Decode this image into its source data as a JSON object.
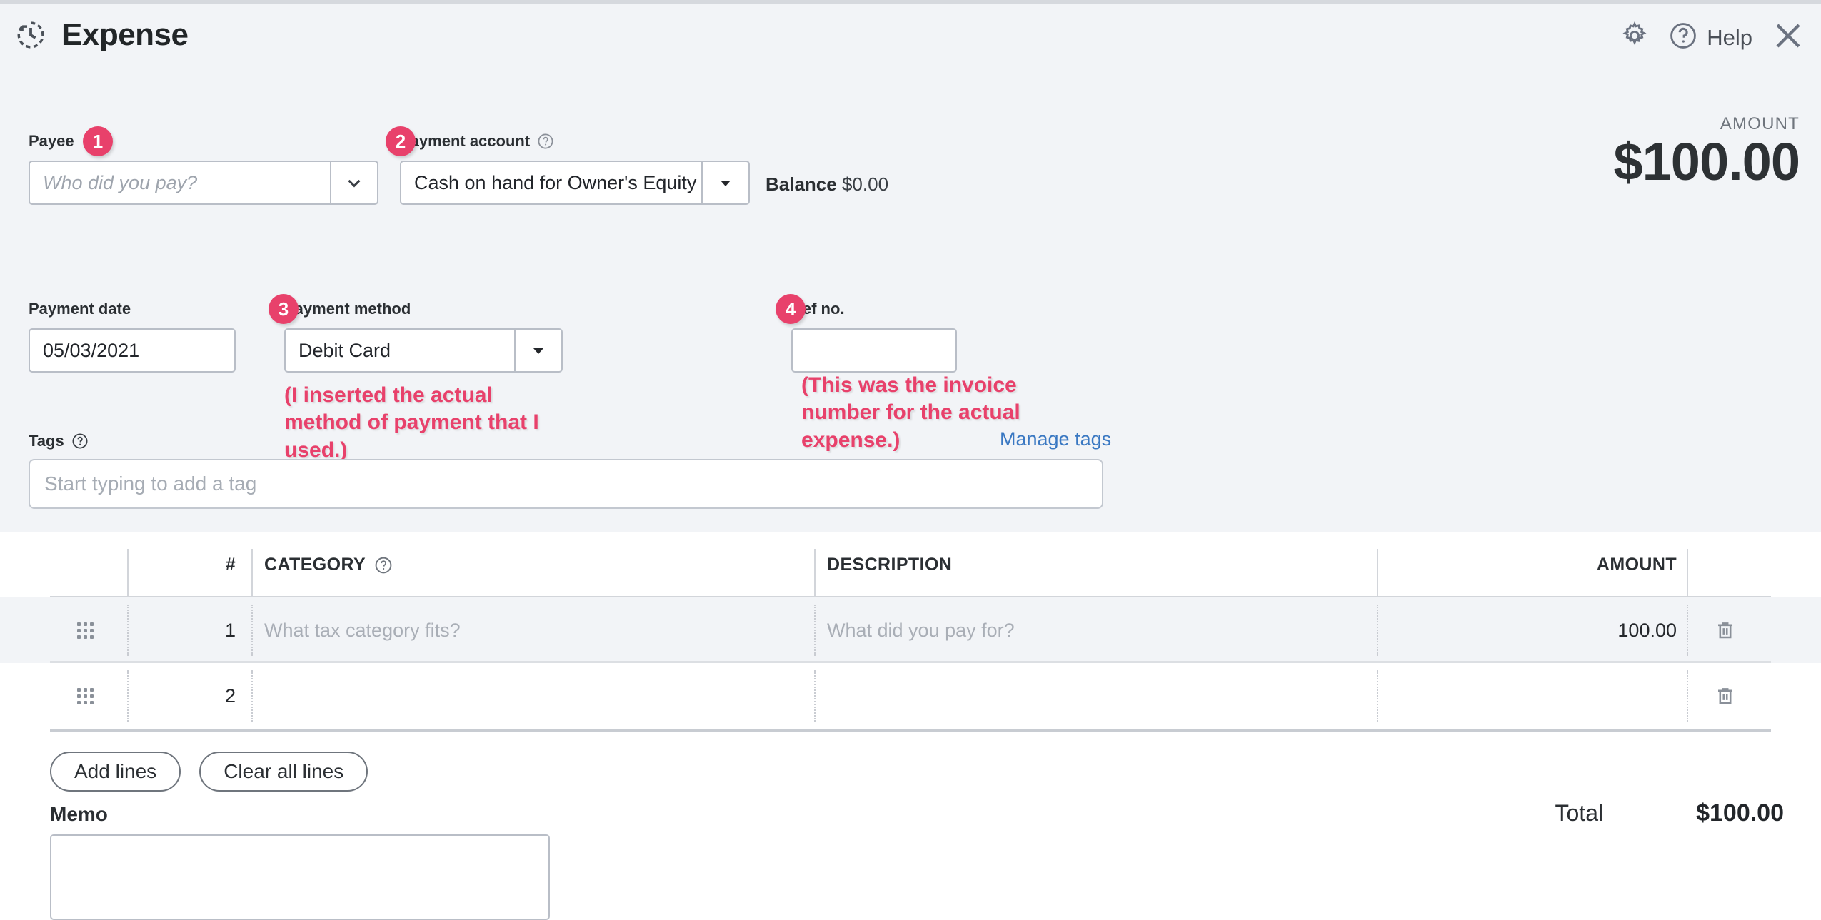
{
  "header": {
    "title": "Expense",
    "logo_icon": "history-clock-icon",
    "gear_icon": "gear-icon",
    "help_icon": "question-circle-icon",
    "help_label": "Help",
    "close_icon": "close-x-icon"
  },
  "colors": {
    "badge": "#e8416b",
    "annotation": "#e8416b",
    "link": "#3a78c2",
    "panel": "#f2f4f7"
  },
  "payee": {
    "label": "Payee",
    "badge": "1",
    "value": "",
    "placeholder": "Who did you pay?",
    "chevron_icon": "chevron-down-icon"
  },
  "payment_account": {
    "label": "Payment account",
    "badge": "2",
    "help_icon": "question-circle-icon",
    "value": "Cash on hand for Owner's Equity",
    "caret_icon": "caret-down-icon",
    "balance_label": "Balance",
    "balance_value": "$0.00"
  },
  "amount": {
    "label": "AMOUNT",
    "value": "$100.00"
  },
  "payment_date": {
    "label": "Payment date",
    "value": "05/03/2021"
  },
  "payment_method": {
    "label": "Payment method",
    "badge": "3",
    "value": "Debit Card",
    "caret_icon": "caret-down-icon",
    "annotation": "(I inserted the actual method of payment that I used.)"
  },
  "ref_no": {
    "label": "Ref no.",
    "badge": "4",
    "value": "",
    "annotation": "(This was the invoice number for the actual expense.)"
  },
  "tags": {
    "label": "Tags",
    "help_icon": "question-circle-icon",
    "value": "",
    "placeholder": "Start typing to add a tag",
    "manage_link": "Manage tags"
  },
  "line_table": {
    "columns": {
      "drag": "",
      "number": "#",
      "category": "CATEGORY",
      "category_help_icon": "question-circle-icon",
      "description": "DESCRIPTION",
      "amount": "AMOUNT"
    },
    "rows": [
      {
        "drag_icon": "drag-handle-icon",
        "number": "1",
        "category": "",
        "category_placeholder": "What tax category fits?",
        "description": "",
        "description_placeholder": "What did you pay for?",
        "amount": "100.00",
        "delete_icon": "trash-icon",
        "highlighted": true
      },
      {
        "drag_icon": "drag-handle-icon",
        "number": "2",
        "category": "",
        "category_placeholder": "",
        "description": "",
        "description_placeholder": "",
        "amount": "",
        "delete_icon": "trash-icon",
        "highlighted": false
      }
    ]
  },
  "footer": {
    "add_lines": "Add lines",
    "clear_all_lines": "Clear all lines",
    "memo_label": "Memo",
    "memo_value": "",
    "total_label": "Total",
    "total_value": "$100.00"
  }
}
